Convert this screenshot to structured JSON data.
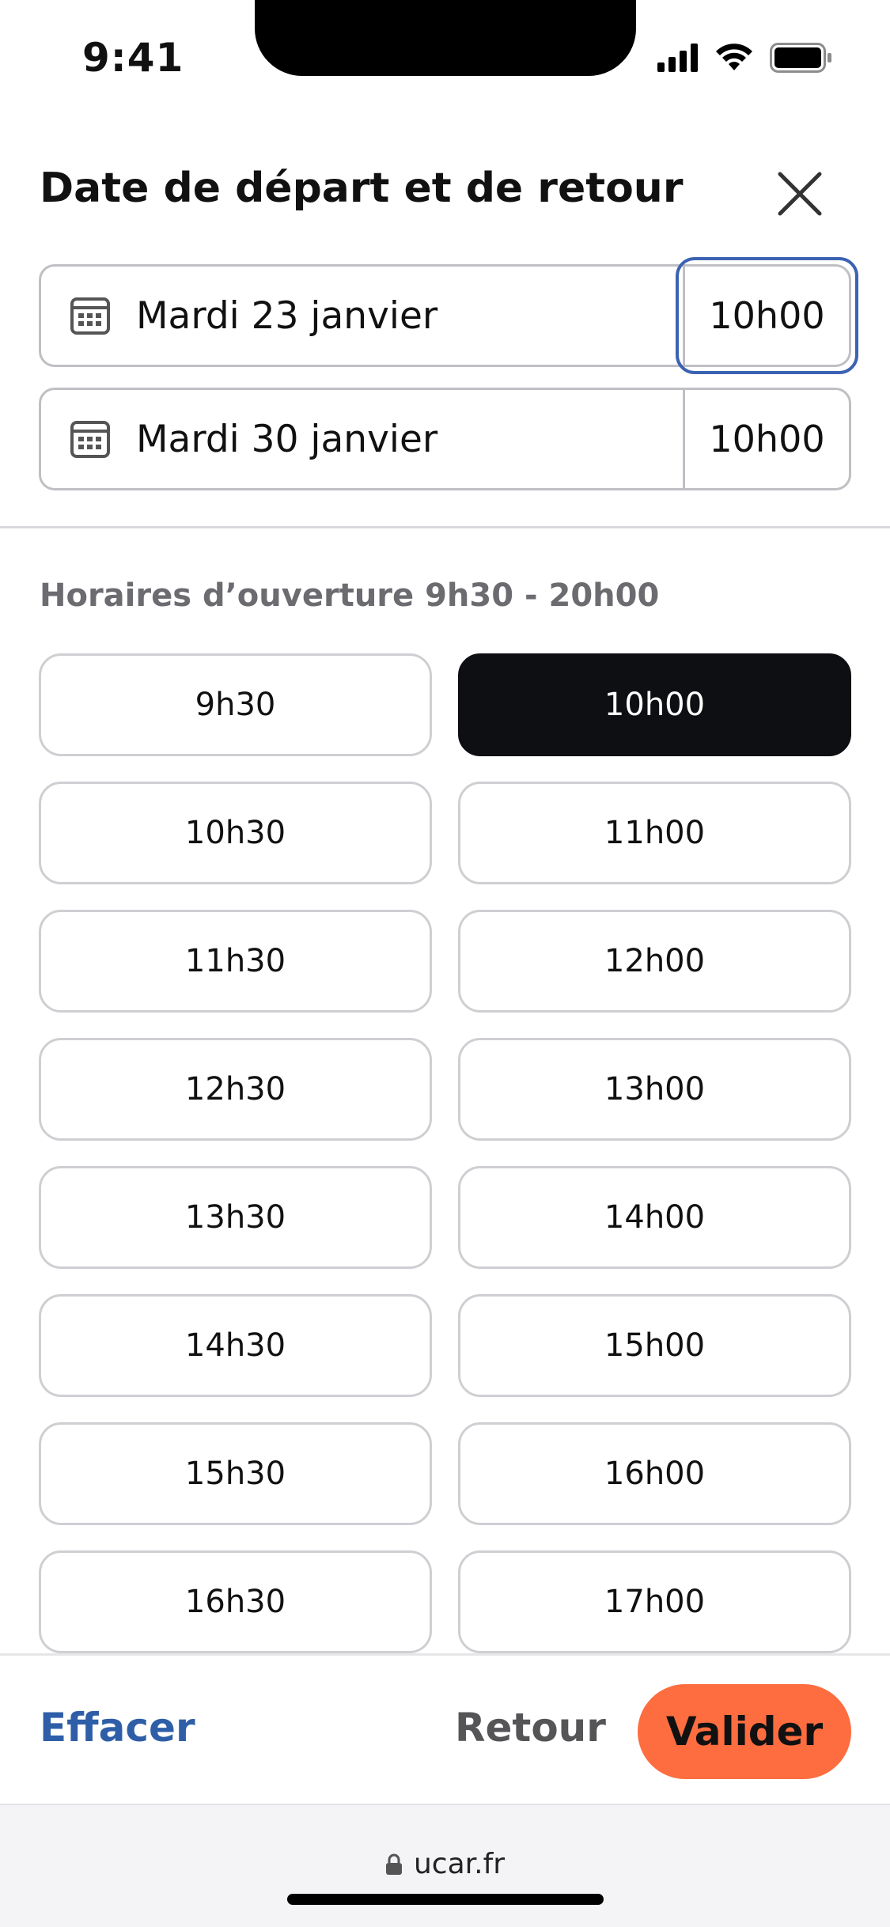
{
  "status_bar": {
    "time": "9:41"
  },
  "header": {
    "title": "Date de départ et de retour"
  },
  "departure": {
    "date": "Mardi 23 janvier",
    "time": "10h00"
  },
  "return": {
    "date": "Mardi 30 janvier",
    "time": "10h00"
  },
  "hours_label": "Horaires d’ouverture 9h30 - 20h00",
  "slots": [
    "9h30",
    "10h00",
    "10h30",
    "11h00",
    "11h30",
    "12h00",
    "12h30",
    "13h00",
    "13h30",
    "14h00",
    "14h30",
    "15h00",
    "15h30",
    "16h00",
    "16h30",
    "17h00"
  ],
  "selected_slot": "10h00",
  "actions": {
    "clear": "Effacer",
    "back": "Retour",
    "validate": "Valider"
  },
  "browser": {
    "url": "ucar.fr"
  },
  "colors": {
    "accent": "#fd6d3f",
    "link": "#2f5ea8",
    "selected": "#0d0f12",
    "focus": "#3b63b2"
  },
  "icons": {
    "close": "close-icon",
    "calendar": "calendar-icon",
    "lock": "lock-icon"
  }
}
